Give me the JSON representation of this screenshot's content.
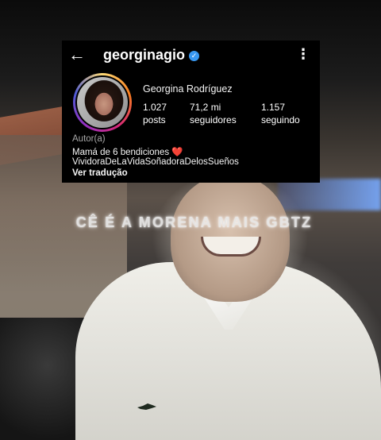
{
  "profile": {
    "username": "georginagio",
    "full_name": "Georgina Rodríguez",
    "stats": {
      "posts_count": "1.027",
      "posts_label": "posts",
      "followers_count": "71,2 mi",
      "followers_label": "seguidores",
      "following_count": "1.157",
      "following_label": "seguindo"
    },
    "category": "Autor(a)",
    "bio_line1": "Mamá de 6 bendiciones",
    "bio_heart": "❤️",
    "bio_line2": "VividoraDeLaVidaSoñadoraDelosSueños",
    "translate_link": "Ver tradução",
    "icons": {
      "back": "←",
      "verified": "✓",
      "more": "⋮"
    },
    "colors": {
      "verified_badge": "#3897f0",
      "heart": "#ed4956"
    }
  },
  "video_overlay": {
    "caption": "CÊ É A MORENA MAIS GBTZ"
  }
}
